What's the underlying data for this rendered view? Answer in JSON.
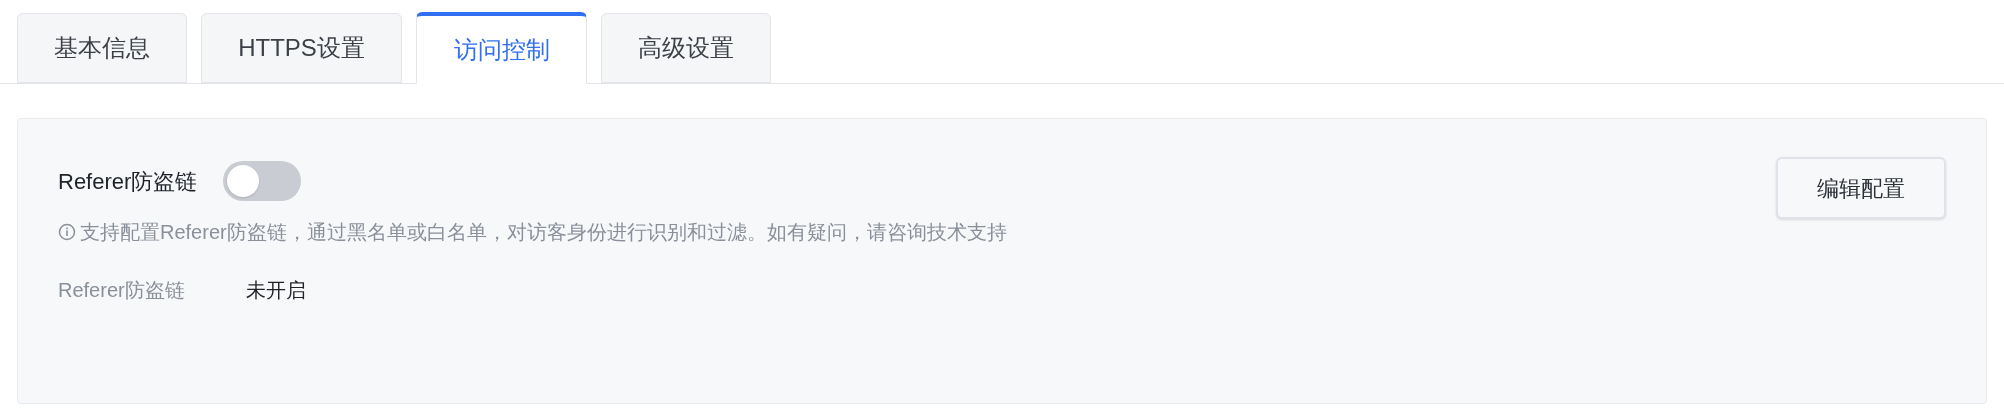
{
  "tabs": [
    {
      "label": "基本信息",
      "selected": false
    },
    {
      "label": "HTTPS设置",
      "selected": false
    },
    {
      "label": "访问控制",
      "selected": true
    },
    {
      "label": "高级设置",
      "selected": false
    }
  ],
  "panel": {
    "switch_label": "Referer防盗链",
    "switch": {
      "on": false
    },
    "hint": "支持配置Referer防盗链，通过黑名单或白名单，对访客身份进行识别和过滤。如有疑问，请咨询技术支持",
    "field_label": "Referer防盗链",
    "field_value": "未开启",
    "button": "编辑配置"
  }
}
